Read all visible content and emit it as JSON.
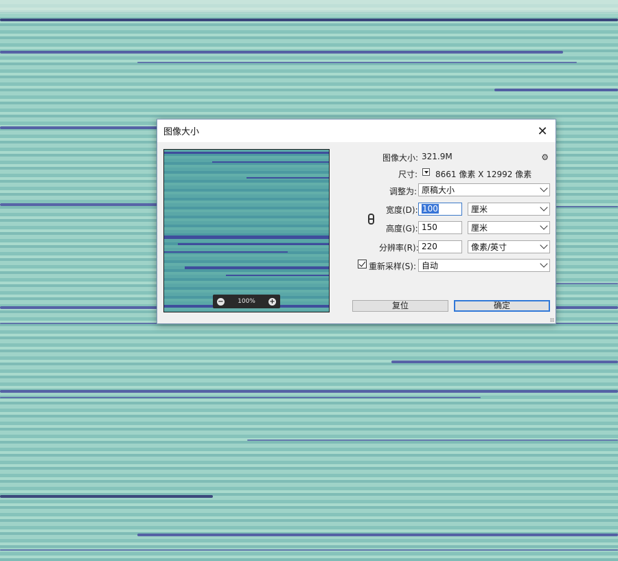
{
  "dialog": {
    "title": "图像大小",
    "image_size_label": "图像大小:",
    "image_size_value": "321.9M",
    "dimensions_label": "尺寸:",
    "dimensions_value": "8661 像素  X  12992 像素",
    "fit_to_label": "调整为:",
    "fit_to_value": "原稿大小",
    "width_label": "宽度(D):",
    "width_value": "100",
    "width_unit": "厘米",
    "height_label": "高度(G):",
    "height_value": "150",
    "height_unit": "厘米",
    "resolution_label": "分辨率(R):",
    "resolution_value": "220",
    "resolution_unit": "像素/英寸",
    "resample_label": "重新采样(S):",
    "resample_checked": true,
    "resample_value": "自动",
    "reset_button": "复位",
    "ok_button": "确定"
  },
  "preview": {
    "zoom_level": "100%"
  },
  "colors": {
    "accent": "#3078d8",
    "selection": "#3875d7",
    "background_teal": "#8ec7bf",
    "streak_indigo": "#4a4fa0"
  },
  "icons": {
    "close": "close-icon",
    "gear": "gear-icon",
    "zoom_out": "zoom-out-icon",
    "zoom_in": "zoom-in-icon",
    "link": "link-icon",
    "dropdown": "chevron-down-icon"
  }
}
